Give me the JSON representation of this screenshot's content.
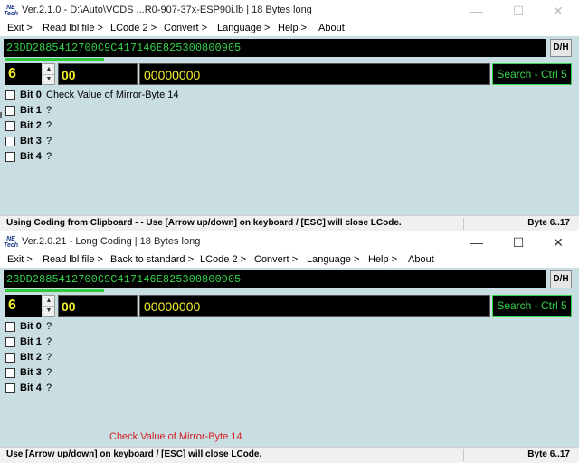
{
  "window1": {
    "logo": "NE-Tech",
    "title": "Ver.2.1.0 - D:\\Auto\\VCDS ...R0-907-37x-ESP90i.lb | 18 Bytes long",
    "menu": [
      "Exit >",
      "Read lbl file >",
      "LCode 2 >",
      "Convert >",
      "Language >",
      "Help >",
      "About"
    ],
    "hex_code": "23DD2885412700C9C417146E825300800905",
    "dh_label": "D/H",
    "progress_fraction": 0.17,
    "byte_index": "6",
    "byte_hex": "00",
    "byte_binary": "00000000",
    "search_label": "Search - Ctrl 5",
    "bits": [
      {
        "label": "Bit 0",
        "desc": "Check Value of Mirror-Byte 14",
        "checked": false
      },
      {
        "label": "Bit 1",
        "desc": "?",
        "checked": false
      },
      {
        "label": "Bit 2",
        "desc": "?",
        "checked": false
      },
      {
        "label": "Bit 3",
        "desc": "?",
        "checked": false
      },
      {
        "label": "Bit 4",
        "desc": "?",
        "checked": false
      }
    ],
    "status": "Using Coding from Clipboard - - Use [Arrow up/down] on keyboard / [ESC] will close LCode.",
    "status_byte": "Byte 6..17"
  },
  "window2": {
    "logo": "NE-Tech",
    "title": "Ver.2.0.21 - Long Coding | 18 Bytes long",
    "menu": [
      "Exit >",
      "Read lbl file >",
      "Back to standard >",
      "LCode 2 >",
      "Convert >",
      "Language >",
      "Help >",
      "About"
    ],
    "hex_code": "23DD2885412700C9C417146E825300800905",
    "dh_label": "D/H",
    "progress_fraction": 0.17,
    "byte_index": "6",
    "byte_hex": "00",
    "byte_binary": "00000000",
    "search_label": "Search - Ctrl 5",
    "bits": [
      {
        "label": "Bit 0",
        "desc": "?",
        "checked": false
      },
      {
        "label": "Bit 1",
        "desc": "?",
        "checked": false
      },
      {
        "label": "Bit 2",
        "desc": "?",
        "checked": false
      },
      {
        "label": "Bit 3",
        "desc": "?",
        "checked": false
      },
      {
        "label": "Bit 4",
        "desc": "?",
        "checked": false
      }
    ],
    "info_message": "Check Value of Mirror-Byte 14",
    "status": "Use [Arrow up/down] on keyboard / [ESC] will close LCode.",
    "status_byte": "Byte 6..17"
  },
  "colors": {
    "client_bg": "#c9dee3",
    "hex_text": "#33d24a",
    "value_text": "#f3ee2a",
    "info_red": "#d42020"
  }
}
